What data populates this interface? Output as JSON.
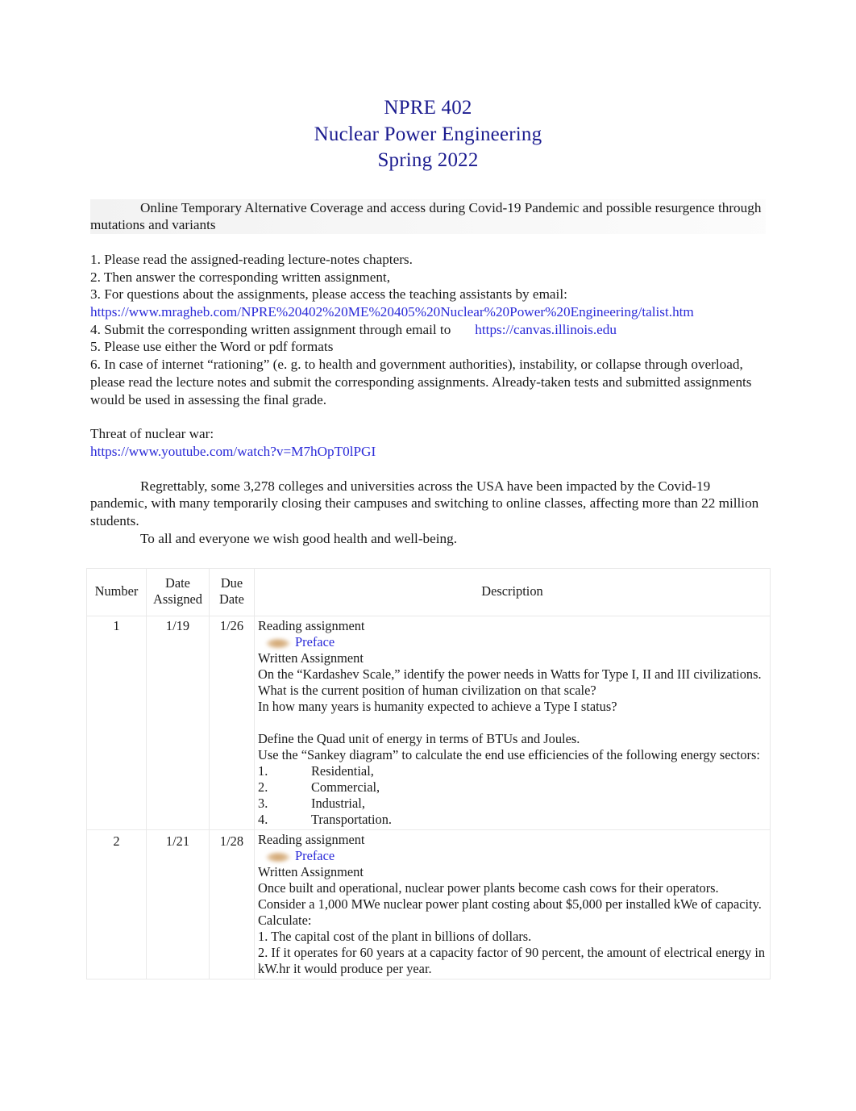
{
  "document": {
    "title_lines": [
      "NPRE 402",
      "Nuclear Power Engineering",
      "Spring 2022"
    ],
    "title_color": "#1b1b8f",
    "link_color": "#2a2ad8"
  },
  "intro": {
    "heading_paragraph": "Online Temporary Alternative Coverage and access during Covid-19 Pandemic and possible resurgence through mutations and variants"
  },
  "instructions": {
    "item1": "1. Please read the assigned-reading lecture-notes chapters.",
    "item2": "2. Then answer the corresponding written assignment,",
    "item3": "3. For questions about the assignments, please access the teaching assistants by email:",
    "item3_url": "https://www.mragheb.com/NPRE%20402%20ME%20405%20Nuclear%20Power%20Engineering/talist.htm",
    "item4_prefix": "4. Submit the corresponding written assignment through email to",
    "item4_url": "https://canvas.illinois.edu",
    "item5": "5. Please use either the Word or pdf formats",
    "item6": "6. In case of internet “rationing” (e. g. to health and government authorities), instability, or collapse through overload, please read the lecture notes and submit the corresponding assignments. Already-taken tests and submitted assignments would be used in assessing the final grade."
  },
  "threat": {
    "label": "Threat of nuclear war:",
    "url": "https://www.youtube.com/watch?v=M7hOpT0lPGI"
  },
  "closing": {
    "paragraph": "Regrettably, some 3,278 colleges and universities across the USA have been impacted by the Covid-19 pandemic, with many temporarily closing their campuses and switching to online classes, affecting more than 22 million students.",
    "wish": "To all and everyone we wish good health and well-being."
  },
  "table": {
    "headers": {
      "number": "Number",
      "date_assigned_l1": "Date",
      "date_assigned_l2": "Assigned",
      "due_date_l1": "Due",
      "due_date_l2": "Date",
      "description": "Description"
    },
    "rows": [
      {
        "number": "1",
        "date_assigned": "1/19",
        "due_date": "1/26",
        "reading_label": "Reading assignment",
        "reading_link": "Preface",
        "written_label": "Written Assignment",
        "lines": [
          "On the “Kardashev Scale,” identify the power needs in Watts for Type I, II and III civilizations.",
          "What is the current position of human civilization on that scale?",
          "In how many years is humanity expected to achieve a Type I status?"
        ],
        "lines2": [
          "Define the Quad unit of energy in terms of BTUs and Joules.",
          "Use the “Sankey diagram” to calculate the end use efficiencies of the following energy sectors:"
        ],
        "sub_items": [
          {
            "num": "1.",
            "text": "Residential,"
          },
          {
            "num": "2.",
            "text": "Commercial,"
          },
          {
            "num": "3.",
            "text": "Industrial,"
          },
          {
            "num": "4.",
            "text": "Transportation."
          }
        ]
      },
      {
        "number": "2",
        "date_assigned": "1/21",
        "due_date": "1/28",
        "reading_label": "Reading assignment",
        "reading_link": "Preface",
        "written_label": "Written Assignment",
        "lines": [
          "Once built and operational, nuclear power plants become cash cows for their operators.",
          "Consider a 1,000 MWe nuclear power plant costing about $5,000 per installed kWe of capacity.",
          "Calculate:",
          "1. The capital cost of the plant in billions of dollars.",
          "2. If it operates for 60 years at a capacity factor of 90 percent, the amount of electrical energy in kW.hr it would produce per year."
        ]
      }
    ]
  }
}
